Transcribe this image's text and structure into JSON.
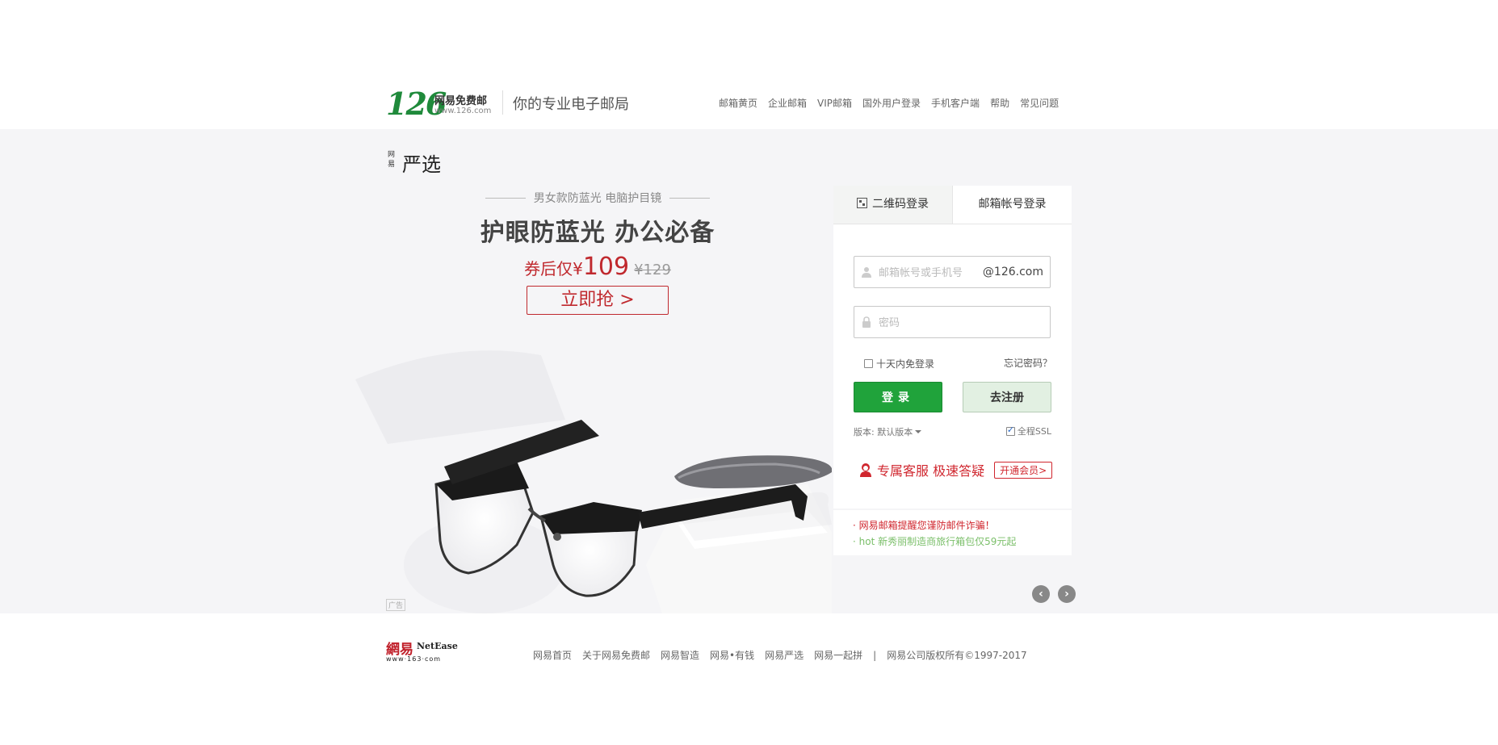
{
  "header": {
    "logo_num": "126",
    "logo_cn": "网易免费邮",
    "logo_url": "www.126.com",
    "slogan": "你的专业电子邮局",
    "nav": [
      "邮箱黄页",
      "企业邮箱",
      "VIP邮箱",
      "国外用户登录",
      "手机客户端",
      "帮助",
      "常见问题"
    ]
  },
  "banner": {
    "brand_small": "网易",
    "brand_big": "严选",
    "promo_sub": "男女款防蓝光 电脑护目镜",
    "promo_title": "护眼防蓝光 办公必备",
    "price_prefix": "券后仅¥",
    "price": "109",
    "old_price": "¥129",
    "cta": "立即抢 >",
    "ad_tag": "广告"
  },
  "login": {
    "tab_qr": "二维码登录",
    "tab_account": "邮箱帐号登录",
    "user_placeholder": "邮箱帐号或手机号",
    "user_suffix": "@126.com",
    "pass_placeholder": "密码",
    "remember": "十天内免登录",
    "forgot": "忘记密码？",
    "login_btn": "登录",
    "register_btn": "去注册",
    "version": "版本: 默认版本",
    "ssl": "全程SSL",
    "vip_text": "专属客服 极速答疑",
    "vip_btn": "开通会员>"
  },
  "notices": [
    "· 网易邮箱提醒您谨防邮件诈骗！",
    "· hot 新秀丽制造商旅行箱包仅59元起"
  ],
  "footer": {
    "ne_cn": "網易",
    "ne_en": "NetEase",
    "ne_url": "www·163·com",
    "nav": [
      "网易首页",
      "关于网易免费邮",
      "网易智造",
      "网易•有钱",
      "网易严选",
      "网易一起拼",
      "|",
      "网易公司版权所有©1997-2017"
    ]
  },
  "colors": {
    "brand_green": "#1f8a3b",
    "login_green": "#20a33b",
    "accent_red": "#c0292e"
  }
}
